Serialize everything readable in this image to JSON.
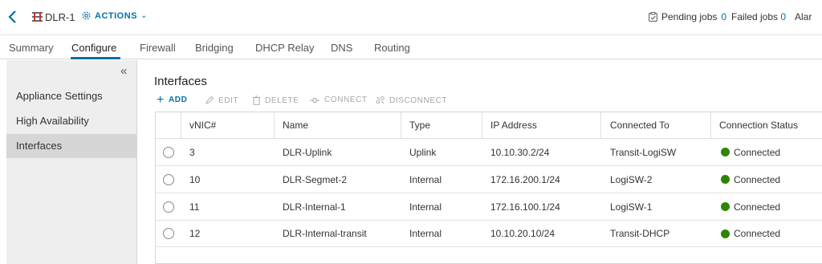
{
  "header": {
    "object_name": "DLR-1",
    "actions_label": "ACTIONS",
    "pending_jobs_label": "Pending jobs",
    "pending_jobs_count": "0",
    "failed_jobs_label": "Failed jobs",
    "failed_jobs_count": "0",
    "alarms_label": "Alar"
  },
  "tabs": [
    {
      "label": "Summary"
    },
    {
      "label": "Configure"
    },
    {
      "label": "Firewall"
    },
    {
      "label": "Bridging"
    },
    {
      "label": "DHCP Relay"
    },
    {
      "label": "DNS"
    },
    {
      "label": "Routing"
    }
  ],
  "active_tab": "Configure",
  "sidebar": {
    "items": [
      {
        "label": "Appliance Settings"
      },
      {
        "label": "High Availability"
      },
      {
        "label": "Interfaces"
      }
    ],
    "active_item": "Interfaces"
  },
  "main": {
    "title": "Interfaces",
    "toolbar": {
      "add": "ADD",
      "edit": "EDIT",
      "delete": "DELETE",
      "connect": "CONNECT",
      "disconnect": "DISCONNECT"
    },
    "columns": [
      "vNIC#",
      "Name",
      "Type",
      "IP Address",
      "Connected To",
      "Connection Status"
    ],
    "rows": [
      {
        "vnic": "3",
        "name": "DLR-Uplink",
        "type": "Uplink",
        "ip": "10.10.30.2/24",
        "connected_to": "Transit-LogiSW",
        "status": "Connected"
      },
      {
        "vnic": "10",
        "name": "DLR-Segmet-2",
        "type": "Internal",
        "ip": "172.16.200.1/24",
        "connected_to": "LogiSW-2",
        "status": "Connected"
      },
      {
        "vnic": "11",
        "name": "DLR-Internal-1",
        "type": "Internal",
        "ip": "172.16.100.1/24",
        "connected_to": "LogiSW-1",
        "status": "Connected"
      },
      {
        "vnic": "12",
        "name": "DLR-Internal-transit",
        "type": "Internal",
        "ip": "10.10.20.10/24",
        "connected_to": "Transit-DHCP",
        "status": "Connected"
      }
    ]
  },
  "colors": {
    "accent": "#0072a3",
    "status_connected": "#2f8400"
  }
}
